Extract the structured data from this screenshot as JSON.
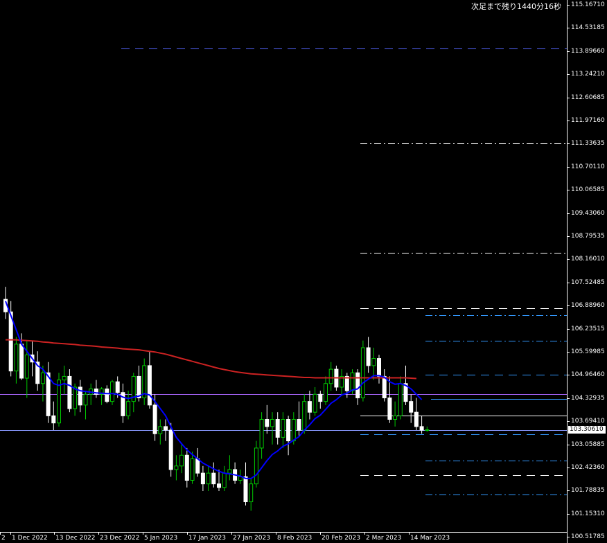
{
  "countdown_text": "次足まで残り1440分16秒",
  "current_price_label": "103.30610",
  "price_axis_labels": [
    "115.16710",
    "114.53185",
    "113.89660",
    "113.24210",
    "112.60685",
    "111.97160",
    "111.33635",
    "110.70110",
    "110.06585",
    "109.43060",
    "108.79535",
    "108.16010",
    "107.52485",
    "106.88960",
    "106.23515",
    "105.59985",
    "104.96460",
    "104.32935",
    "103.69410",
    "103.05885",
    "102.42360",
    "101.78835",
    "101.15310",
    "100.51785"
  ],
  "time_axis_labels": [
    "2",
    "1 Dec 2022",
    "13 Dec 2022",
    "23 Dec 2022",
    "5 Jan 2023",
    "17 Jan 2023",
    "27 Jan 2023",
    "8 Feb 2023",
    "20 Feb 2023",
    "2 Mar 2023",
    "14 Mar 2023"
  ],
  "colors": {
    "background": "#000000",
    "bull_candle": "#00cc00",
    "bear_candle": "#ffffff",
    "ma_fast": "#0000ff",
    "ma_slow": "#cc2222",
    "level_purple": "#aa66ff",
    "level_blue": "#5577ff",
    "level_white": "#ffffff",
    "level_dashblue": "#3399ff"
  },
  "chart_data": {
    "type": "candlestick",
    "x": [
      "2022-11-29",
      "2022-11-30",
      "2022-12-01",
      "2022-12-02",
      "2022-12-05",
      "2022-12-06",
      "2022-12-07",
      "2022-12-08",
      "2022-12-09",
      "2022-12-12",
      "2022-12-13",
      "2022-12-14",
      "2022-12-15",
      "2022-12-16",
      "2022-12-19",
      "2022-12-20",
      "2022-12-21",
      "2022-12-22",
      "2022-12-23",
      "2022-12-26",
      "2022-12-27",
      "2022-12-28",
      "2022-12-29",
      "2022-12-30",
      "2023-01-02",
      "2023-01-03",
      "2023-01-04",
      "2023-01-05",
      "2023-01-06",
      "2023-01-09",
      "2023-01-10",
      "2023-01-11",
      "2023-01-12",
      "2023-01-13",
      "2023-01-16",
      "2023-01-17",
      "2023-01-18",
      "2023-01-19",
      "2023-01-20",
      "2023-01-23",
      "2023-01-24",
      "2023-01-25",
      "2023-01-26",
      "2023-01-27",
      "2023-01-30",
      "2023-01-31",
      "2023-02-01",
      "2023-02-02",
      "2023-02-03",
      "2023-02-06",
      "2023-02-07",
      "2023-02-08",
      "2023-02-09",
      "2023-02-10",
      "2023-02-13",
      "2023-02-14",
      "2023-02-15",
      "2023-02-16",
      "2023-02-17",
      "2023-02-20",
      "2023-02-21",
      "2023-02-22",
      "2023-02-23",
      "2023-02-24",
      "2023-02-27",
      "2023-02-28",
      "2023-03-01",
      "2023-03-02",
      "2023-03-03",
      "2023-03-06",
      "2023-03-07",
      "2023-03-08",
      "2023-03-09",
      "2023-03-10",
      "2023-03-13",
      "2023-03-14",
      "2023-03-15",
      "2023-03-16",
      "2023-03-17",
      "2023-03-20"
    ],
    "ohlc": [
      [
        106.95,
        107.3,
        106.4,
        106.6
      ],
      [
        106.6,
        106.9,
        104.8,
        104.95
      ],
      [
        104.95,
        105.9,
        104.6,
        105.7
      ],
      [
        105.7,
        106.0,
        104.7,
        104.75
      ],
      [
        104.75,
        105.8,
        104.2,
        105.4
      ],
      [
        105.4,
        105.8,
        104.8,
        105.2
      ],
      [
        105.2,
        105.5,
        104.4,
        104.6
      ],
      [
        104.6,
        105.1,
        104.1,
        104.9
      ],
      [
        104.9,
        105.2,
        103.5,
        103.7
      ],
      [
        103.7,
        104.1,
        103.3,
        103.5
      ],
      [
        103.5,
        104.9,
        103.4,
        104.7
      ],
      [
        104.7,
        105.1,
        104.3,
        104.8
      ],
      [
        104.8,
        105.0,
        103.8,
        103.9
      ],
      [
        103.9,
        104.6,
        103.7,
        104.5
      ],
      [
        104.5,
        104.7,
        103.8,
        104.0
      ],
      [
        104.0,
        104.4,
        103.6,
        104.3
      ],
      [
        104.3,
        104.6,
        104.0,
        104.45
      ],
      [
        104.45,
        104.7,
        104.2,
        104.3
      ],
      [
        104.3,
        104.5,
        104.0,
        104.45
      ],
      [
        104.45,
        104.55,
        104.05,
        104.1
      ],
      [
        104.1,
        104.7,
        104.0,
        104.65
      ],
      [
        104.65,
        104.8,
        104.2,
        104.35
      ],
      [
        104.35,
        104.6,
        103.5,
        103.7
      ],
      [
        103.7,
        104.4,
        103.6,
        104.1
      ],
      [
        104.1,
        104.9,
        103.8,
        104.8
      ],
      [
        104.8,
        105.1,
        104.1,
        104.2
      ],
      [
        104.2,
        105.3,
        104.0,
        105.1
      ],
      [
        105.1,
        105.5,
        103.9,
        104.0
      ],
      [
        104.0,
        104.3,
        103.0,
        103.2
      ],
      [
        103.2,
        103.6,
        102.9,
        103.4
      ],
      [
        103.4,
        103.6,
        103.0,
        103.3
      ],
      [
        103.3,
        103.5,
        102.0,
        102.2
      ],
      [
        102.2,
        102.6,
        101.9,
        102.3
      ],
      [
        102.3,
        102.9,
        102.1,
        102.6
      ],
      [
        102.6,
        102.8,
        101.7,
        101.9
      ],
      [
        101.9,
        102.7,
        101.8,
        102.5
      ],
      [
        102.5,
        102.8,
        102.0,
        102.1
      ],
      [
        102.1,
        102.3,
        101.6,
        101.8
      ],
      [
        101.8,
        102.3,
        101.6,
        102.1
      ],
      [
        102.1,
        102.4,
        101.7,
        101.8
      ],
      [
        101.8,
        102.2,
        101.6,
        101.7
      ],
      [
        101.7,
        102.3,
        101.6,
        102.1
      ],
      [
        102.1,
        102.6,
        101.9,
        102.2
      ],
      [
        102.2,
        102.4,
        101.8,
        101.9
      ],
      [
        101.9,
        102.2,
        101.8,
        102.0
      ],
      [
        102.0,
        102.4,
        101.2,
        101.3
      ],
      [
        101.3,
        101.95,
        101.05,
        101.8
      ],
      [
        101.8,
        103.0,
        101.7,
        102.8
      ],
      [
        102.8,
        103.8,
        102.5,
        103.6
      ],
      [
        103.6,
        104.0,
        103.2,
        103.4
      ],
      [
        103.4,
        103.8,
        102.9,
        103.6
      ],
      [
        103.6,
        103.8,
        102.9,
        103.1
      ],
      [
        103.1,
        103.8,
        102.8,
        103.6
      ],
      [
        103.6,
        103.7,
        102.6,
        103.0
      ],
      [
        103.0,
        103.8,
        102.9,
        103.6
      ],
      [
        103.6,
        104.1,
        103.1,
        103.3
      ],
      [
        103.3,
        104.3,
        103.2,
        104.1
      ],
      [
        104.1,
        104.4,
        103.6,
        103.8
      ],
      [
        103.8,
        104.5,
        103.7,
        104.3
      ],
      [
        104.3,
        104.4,
        103.9,
        104.1
      ],
      [
        104.1,
        104.8,
        104.0,
        104.6
      ],
      [
        104.6,
        105.2,
        104.4,
        105.0
      ],
      [
        105.0,
        105.1,
        104.4,
        104.5
      ],
      [
        104.5,
        105.0,
        104.3,
        104.8
      ],
      [
        104.8,
        104.9,
        104.2,
        104.4
      ],
      [
        104.4,
        105.0,
        104.3,
        104.9
      ],
      [
        104.9,
        105.0,
        104.0,
        104.2
      ],
      [
        104.2,
        105.8,
        104.1,
        105.6
      ],
      [
        105.6,
        105.9,
        104.9,
        105.1
      ],
      [
        105.1,
        105.6,
        104.7,
        105.3
      ],
      [
        105.3,
        105.4,
        104.6,
        104.8
      ],
      [
        104.8,
        105.0,
        104.1,
        104.2
      ],
      [
        104.2,
        104.8,
        103.5,
        103.6
      ],
      [
        103.6,
        104.1,
        103.4,
        103.7
      ],
      [
        103.7,
        104.8,
        103.6,
        104.6
      ],
      [
        104.6,
        105.1,
        104.0,
        104.1
      ],
      [
        104.1,
        104.3,
        103.5,
        103.8
      ],
      [
        103.8,
        104.2,
        103.3,
        103.4
      ],
      [
        103.4,
        103.7,
        103.2,
        103.3
      ],
      [
        103.3,
        103.4,
        103.25,
        103.31
      ]
    ],
    "ma_fast": [
      106.9,
      106.5,
      106.1,
      105.7,
      105.5,
      105.3,
      105.1,
      105.0,
      104.8,
      104.6,
      104.55,
      104.6,
      104.55,
      104.45,
      104.4,
      104.38,
      104.36,
      104.34,
      104.33,
      104.32,
      104.32,
      104.3,
      104.22,
      104.18,
      104.22,
      104.25,
      104.32,
      104.28,
      104.1,
      103.9,
      103.7,
      103.4,
      103.1,
      102.92,
      102.75,
      102.62,
      102.5,
      102.38,
      102.3,
      102.22,
      102.15,
      102.1,
      102.08,
      102.05,
      102.02,
      101.95,
      101.95,
      102.05,
      102.25,
      102.45,
      102.62,
      102.72,
      102.85,
      102.92,
      103.02,
      103.12,
      103.3,
      103.45,
      103.62,
      103.72,
      103.88,
      104.05,
      104.15,
      104.28,
      104.33,
      104.42,
      104.45,
      104.62,
      104.72,
      104.82,
      104.82,
      104.78,
      104.65,
      104.58,
      104.6,
      104.55,
      104.45,
      104.3,
      104.15
    ],
    "ma_slow": [
      105.82,
      105.82,
      105.82,
      105.81,
      105.8,
      105.79,
      105.78,
      105.76,
      105.75,
      105.73,
      105.72,
      105.71,
      105.7,
      105.69,
      105.67,
      105.66,
      105.65,
      105.64,
      105.62,
      105.61,
      105.6,
      105.59,
      105.57,
      105.56,
      105.55,
      105.54,
      105.52,
      105.5,
      105.48,
      105.45,
      105.42,
      105.38,
      105.34,
      105.3,
      105.26,
      105.22,
      105.18,
      105.14,
      105.1,
      105.06,
      105.02,
      104.99,
      104.96,
      104.93,
      104.91,
      104.89,
      104.87,
      104.86,
      104.85,
      104.84,
      104.83,
      104.82,
      104.81,
      104.8,
      104.79,
      104.78,
      104.77,
      104.77,
      104.76,
      104.76,
      104.76,
      104.76,
      104.76,
      104.76,
      104.76,
      104.76,
      104.76,
      104.76,
      104.76,
      104.76,
      104.76,
      104.76,
      104.76,
      104.76,
      104.76,
      104.76,
      104.75,
      104.74
    ],
    "levels": [
      {
        "price": 113.95,
        "color": "#5566ff",
        "style": "dashed"
      },
      {
        "price": 111.3,
        "color": "#ffffff",
        "style": "dashdot"
      },
      {
        "price": 108.25,
        "color": "#ffffff",
        "style": "dashdot"
      },
      {
        "price": 106.7,
        "color": "#ffffff",
        "style": "dashed"
      },
      {
        "price": 106.5,
        "color": "#3399ff",
        "style": "dashdot"
      },
      {
        "price": 105.8,
        "color": "#3399ff",
        "style": "dashdot"
      },
      {
        "price": 104.85,
        "color": "#3399ff",
        "style": "dashed"
      },
      {
        "price": 104.3,
        "color": "#aa66ff",
        "style": "solid"
      },
      {
        "price": 104.17,
        "color": "#3399ff",
        "style": "solid"
      },
      {
        "price": 103.7,
        "color": "#ffffff",
        "style": "solid"
      },
      {
        "price": 103.3,
        "color": "#8899ff",
        "style": "solid"
      },
      {
        "price": 103.18,
        "color": "#3399ff",
        "style": "dashed"
      },
      {
        "price": 102.45,
        "color": "#3399ff",
        "style": "dashdot"
      },
      {
        "price": 102.05,
        "color": "#ffffff",
        "style": "dashed"
      },
      {
        "price": 101.5,
        "color": "#3399ff",
        "style": "dashdot"
      }
    ],
    "ylim": [
      100.51785,
      115.1671
    ]
  }
}
